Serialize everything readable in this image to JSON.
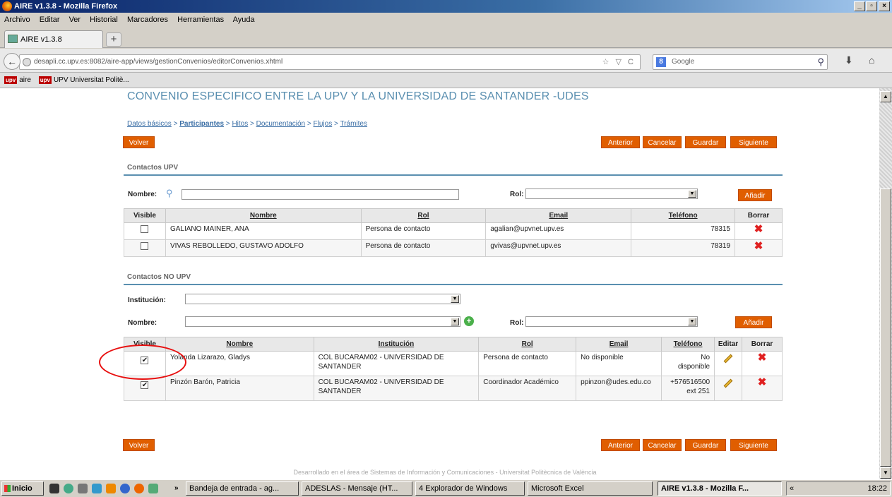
{
  "window": {
    "title": "AIRE v1.3.8 - Mozilla Firefox",
    "buttons": [
      "_",
      "▫",
      "×"
    ]
  },
  "menu": [
    "Archivo",
    "Editar",
    "Ver",
    "Historial",
    "Marcadores",
    "Herramientas",
    "Ayuda"
  ],
  "tab": {
    "label": "AIRE v1.3.8",
    "new": "+"
  },
  "nav": {
    "url": "desapli.cc.upv.es:8082/aire-app/views/gestionConvenios/editorConvenios.xhtml",
    "search_placeholder": "Google",
    "star": "☆ ▽ C"
  },
  "bookmarks": [
    {
      "icon": "upv",
      "label": "aire"
    },
    {
      "icon": "upv",
      "label": "UPV Universitat Politè..."
    }
  ],
  "page": {
    "title": "CONVENIO ESPECIFICO ENTRE LA UPV Y LA UNIVERSIDAD DE SANTANDER -UDES",
    "breadcrumb": {
      "datos": "Datos básicos",
      "sep": " > ",
      "participantes": "Participantes",
      "hitos": "Hitos",
      "documentacion": "Documentación",
      "flujos": "Flujos",
      "tramites": "Trámites"
    },
    "buttons": {
      "volver": "Volver",
      "anterior": "Anterior",
      "cancelar": "Cancelar",
      "guardar": "Guardar",
      "siguiente": "Siguiente",
      "anadir": "Añadir"
    },
    "upv": {
      "section": "Contactos UPV",
      "nombre_label": "Nombre:",
      "rol_label": "Rol:",
      "headers": [
        "Visible",
        "Nombre",
        "Rol",
        "Email",
        "Teléfono",
        "Borrar"
      ],
      "rows": [
        {
          "visible": false,
          "nombre": "GALIANO MAINER, ANA",
          "rol": "Persona de contacto",
          "email": "agalian@upvnet.upv.es",
          "telefono": "78315"
        },
        {
          "visible": false,
          "nombre": "VIVAS REBOLLEDO, GUSTAVO ADOLFO",
          "rol": "Persona de contacto",
          "email": "gvivas@upvnet.upv.es",
          "telefono": "78319"
        }
      ]
    },
    "noupv": {
      "section": "Contactos NO UPV",
      "institucion_label": "Institución:",
      "nombre_label": "Nombre:",
      "rol_label": "Rol:",
      "headers": [
        "Visible",
        "Nombre",
        "Institución",
        "Rol",
        "Email",
        "Teléfono",
        "Editar",
        "Borrar"
      ],
      "rows": [
        {
          "visible": true,
          "nombre": "Yolanda Lizarazo, Gladys",
          "institucion_1": "COL BUCARAM02 - UNIVERSIDAD DE",
          "institucion_2": "SANTANDER",
          "rol": "Persona de contacto",
          "email": "No disponible",
          "telefono_1": "No",
          "telefono_2": "disponible"
        },
        {
          "visible": true,
          "nombre": "Pinzón Barón, Patricia",
          "institucion_1": "COL BUCARAM02 - UNIVERSIDAD DE",
          "institucion_2": "SANTANDER",
          "rol": "Coordinador Académico",
          "email": "ppinzon@udes.edu.co",
          "telefono_1": "+576516500",
          "telefono_2": "ext 251"
        }
      ]
    },
    "footer": "Desarrollado en el área de Sistemas de Información y Comunicaciones - Universitat Politècnica de València"
  },
  "taskbar": {
    "start": "Inicio",
    "more": "»",
    "items": [
      "Bandeja de entrada - ag...",
      "ADESLAS - Mensaje (HT...",
      "4 Explorador de Windows",
      "Microsoft Excel",
      "AIRE v1.3.8 - Mozilla F..."
    ],
    "clock": "18:22",
    "tray_more": "«"
  },
  "colors": {
    "accent": "#e05e00",
    "title": "#5a8fb0",
    "link": "#3a6ea5",
    "delete": "#e02020",
    "annotation": "#e81010"
  }
}
